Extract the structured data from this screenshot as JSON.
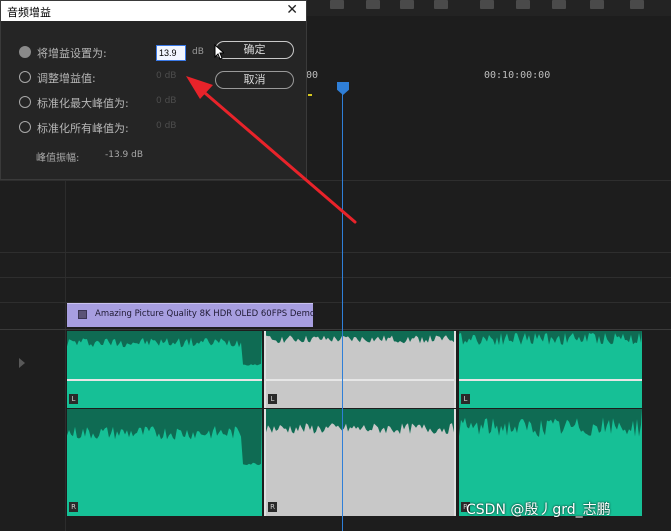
{
  "dialog": {
    "title": "音频增益",
    "close_symbol": "✕",
    "options": [
      {
        "label": "将增益设置为:",
        "value": "",
        "selected": true
      },
      {
        "label": "调整增益值:",
        "value": "0 dB",
        "selected": false
      },
      {
        "label": "标准化最大峰值为:",
        "value": "0 dB",
        "selected": false
      },
      {
        "label": "标准化所有峰值为:",
        "value": "0 dB",
        "selected": false
      }
    ],
    "gain_value": "13.9",
    "gain_unit": "dB",
    "ok_label": "确定",
    "cancel_label": "取消",
    "peak_label": "峰值振幅:",
    "peak_value": "-13.9 dB"
  },
  "timeline": {
    "ruler_labels": [
      "00",
      "00:10:00:00"
    ],
    "video_clip_title": "Amazing Picture Quality 8K HDR OLED 60FPS Demo.",
    "channels": [
      "L",
      "R"
    ]
  },
  "colors": {
    "audio_clip": "#16c096",
    "audio_clip_selected": "#c8c8c8",
    "waveform": "#0f6b53",
    "video_clip": "#a79ee0",
    "playhead": "#2f7fd8",
    "annotation_arrow": "#e8232a"
  },
  "watermark": "CSDN @殷丿grd_志鹏"
}
